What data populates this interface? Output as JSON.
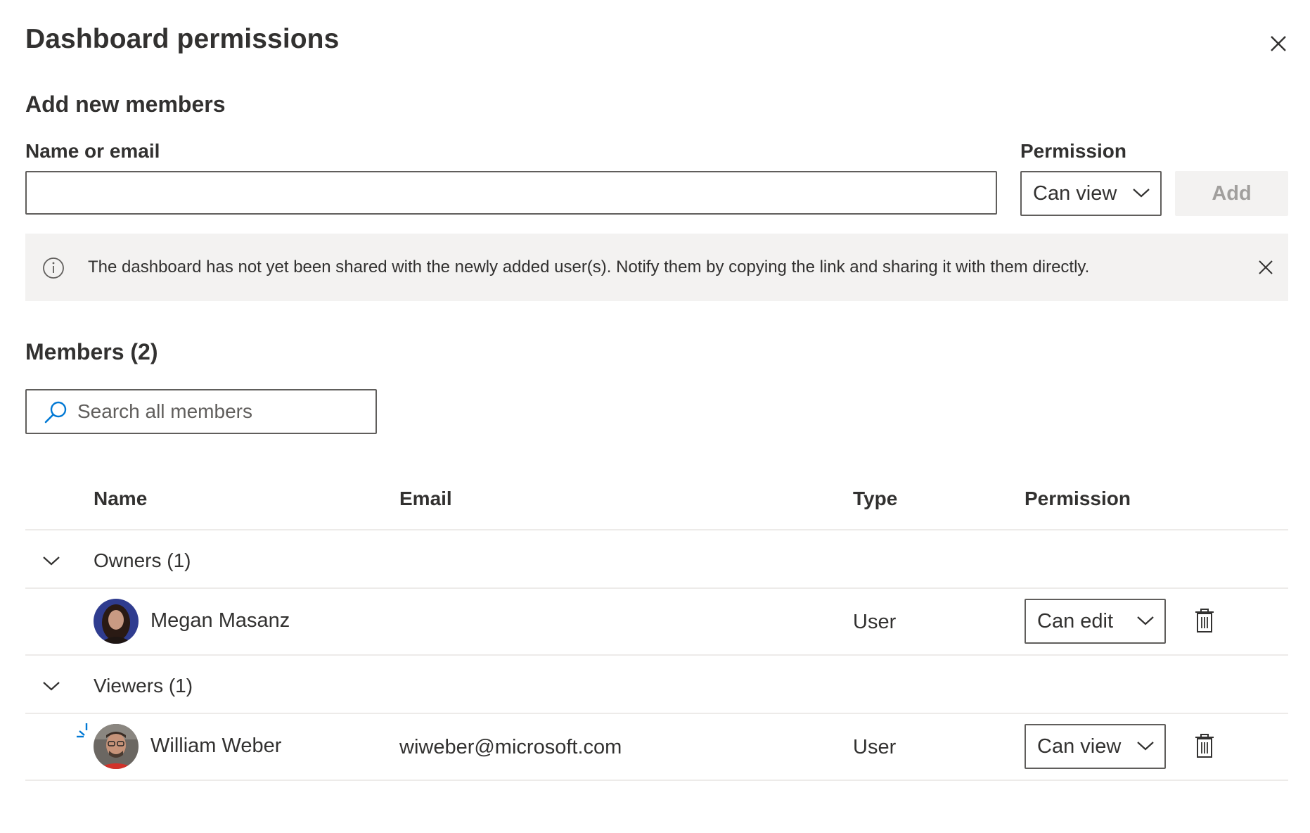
{
  "title": "Dashboard permissions",
  "add_section": {
    "heading": "Add new members",
    "name_label": "Name or email",
    "name_value": "",
    "permission_label": "Permission",
    "permission_value": "Can view",
    "add_button": "Add"
  },
  "info_bar": {
    "message": "The dashboard has not yet been shared with the newly added user(s). Notify them by copying the link and sharing it with them directly."
  },
  "members": {
    "heading": "Members (2)",
    "search_placeholder": "Search all members",
    "columns": [
      "Name",
      "Email",
      "Type",
      "Permission"
    ],
    "groups": [
      {
        "label": "Owners (1)",
        "rows": [
          {
            "name": "Megan Masanz",
            "email": "",
            "type": "User",
            "permission": "Can edit"
          }
        ]
      },
      {
        "label": "Viewers (1)",
        "rows": [
          {
            "name": "William Weber",
            "email": "wiweber@microsoft.com",
            "type": "User",
            "permission": "Can view"
          }
        ]
      }
    ]
  },
  "icons": {
    "close": "close-icon",
    "info": "info-icon",
    "search": "search-icon",
    "chevron": "chevron-down-icon",
    "delete": "trash-icon"
  },
  "colors": {
    "text": "#323130",
    "border": "#605e5c",
    "info_bg": "#f3f2f1",
    "disabled_text": "#a19f9d",
    "accent": "#0078d4"
  }
}
